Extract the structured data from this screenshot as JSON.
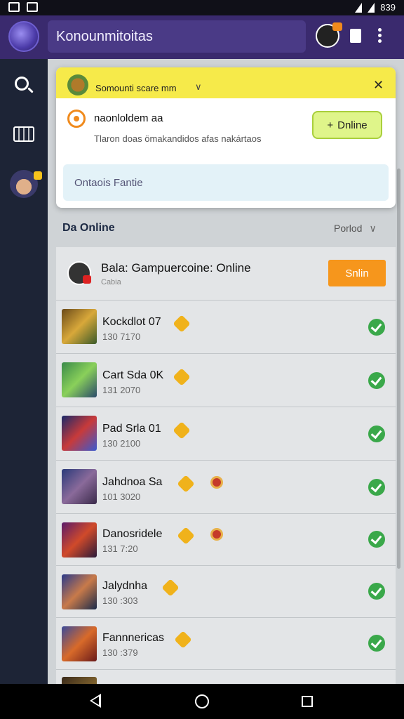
{
  "status_bar": {
    "time": "839"
  },
  "app_bar": {
    "title": "Konounmitoitas"
  },
  "popup": {
    "tab_label": "Somounti scare mm",
    "chevron": "∨",
    "close": "✕",
    "row_title": "naonloldem aa",
    "row_subtitle": "Tlaron doas ömakandidos afas nakártaos",
    "online_button": "Dnline",
    "online_button_plus": "+",
    "input_placeholder": "Ontaois Fantie"
  },
  "section": {
    "title": "Da Online",
    "filter": "Porlod",
    "filter_chevron": "∨"
  },
  "featured": {
    "title": "Bala: Gampuercoine: Online",
    "subtitle": "Cabia",
    "button": "Snlin"
  },
  "rows": [
    {
      "name": "Kockdlot 07",
      "count": "130 7170"
    },
    {
      "name": "Cart Sda 0K",
      "count": "131 2070"
    },
    {
      "name": "Pad Srla 01",
      "count": "130 2100"
    },
    {
      "name": "Jahdnoa Sa",
      "count": "101 3020"
    },
    {
      "name": "Danosridele",
      "count": "131 7:20"
    },
    {
      "name": "Jalydnha",
      "count": "130 :303"
    },
    {
      "name": "Fannnericas",
      "count": "130 :379"
    }
  ],
  "colors": {
    "accent": "#3a2a6e",
    "online": "#3aa84a",
    "action": "#f6961c",
    "popup_header": "#f6ea4a"
  }
}
